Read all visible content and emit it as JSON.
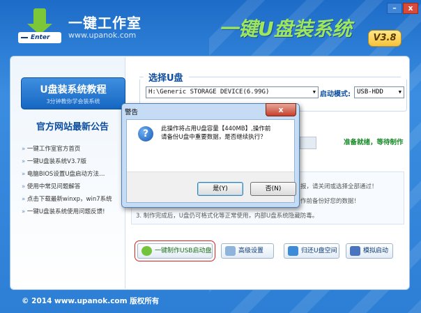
{
  "header": {
    "logo_text": "Enter",
    "brand_name": "一键工作室",
    "brand_url": "www.upanok.com",
    "app_title": "一键U盘装系统",
    "version": "V3.8",
    "minimize": "–",
    "close": "x"
  },
  "sidebar": {
    "tutorial_title": "U盘装系统教程",
    "tutorial_sub": "3分钟教你学会装系统",
    "news_heading": "官方网站最新公告",
    "news": [
      "一键工作室官方首页",
      "一键U盘装系统V3.7版",
      "电脑BIOS设置U盘启动方法…",
      "使用中常见问题解答",
      "点击下载最新winxp，win7系统",
      "一键U盘装系统使用问题反馈!"
    ]
  },
  "main": {
    "select_heading": "选择U盘",
    "drive_value": "H:\\Generic STORAGE DEVICE(6.99G)",
    "boot_mode_label": "启动模式:",
    "boot_mode_value": "USB-HDD",
    "status_text": "准备就绪，等待制作",
    "notes": [
      "报，请关闭或选择全部通过！",
      "作前备份好您的数据！",
      "3. 制作完成后，U盘仍可格式化等正常使用，内部U盘系统隐藏防毒。"
    ],
    "buttons": {
      "usb": "一键制作USB启动盘",
      "advanced": "高级设置",
      "restore": "归还U盘空间",
      "simulate": "模拟启动"
    }
  },
  "footer": {
    "copyright": "© 2014 www.upanok.com  版权所有"
  },
  "dialog": {
    "title": "警告",
    "close": "x",
    "message_line1": "此操作将占用U盘容量【440MB】,操作前",
    "message_line2": "请备份U盘中重要数据，是否继续执行？",
    "yes": "是(Y)",
    "no": "否(N)"
  },
  "colors": {
    "header_bg": "#2d7fd6",
    "title_green": "#9ee75b",
    "heading_blue": "#0c4da0",
    "status_green": "#1a8a2a",
    "highlight_red": "#e02020"
  }
}
